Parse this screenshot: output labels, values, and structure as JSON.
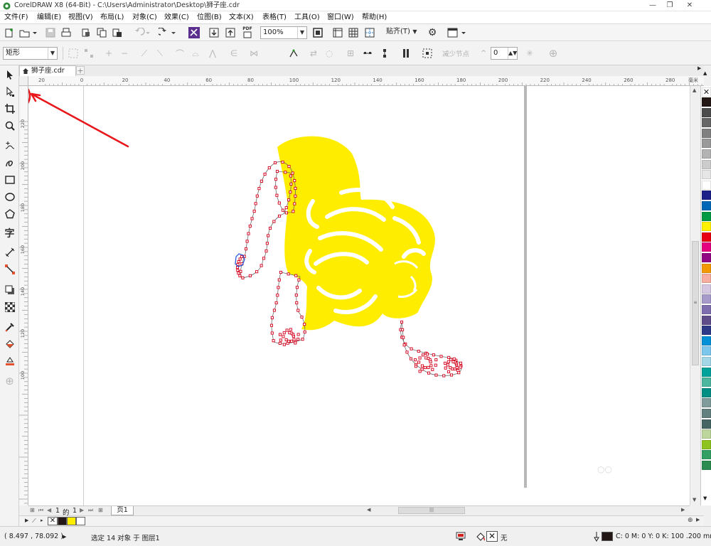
{
  "window": {
    "title": "CorelDRAW X8 (64-Bit) - C:\\Users\\Administrator\\Desktop\\狮子座.cdr",
    "minimize": "—",
    "restore": "❐",
    "close": "✕"
  },
  "menu": [
    {
      "label": "文件(F)"
    },
    {
      "label": "编辑(E)"
    },
    {
      "label": "视图(V)"
    },
    {
      "label": "布局(L)"
    },
    {
      "label": "对象(C)"
    },
    {
      "label": "效果(C)"
    },
    {
      "label": "位图(B)"
    },
    {
      "label": "文本(X)"
    },
    {
      "label": "表格(T)"
    },
    {
      "label": "工具(O)"
    },
    {
      "label": "窗口(W)"
    },
    {
      "label": "帮助(H)"
    }
  ],
  "standard_toolbar": {
    "pdf_label": "PDF",
    "zoom_value": "100%",
    "snap_label": "贴齐(T)"
  },
  "property_bar": {
    "shape_type": "矩形",
    "reduce_nodes_label": "减少节点",
    "smoothness_value": "0"
  },
  "document": {
    "tab_label": "狮子座.cdr"
  },
  "rulers": {
    "horizontal": [
      "20",
      "0",
      "20",
      "40",
      "60",
      "80",
      "100",
      "120",
      "140",
      "160",
      "180",
      "200",
      "220",
      "240",
      "260",
      "280",
      "毫米"
    ],
    "vertical": [
      "220",
      "200",
      "180",
      "160",
      "140",
      "120",
      "100"
    ]
  },
  "page_nav": {
    "current": "1",
    "of_label": "的",
    "total": "1",
    "page_tab": "页1"
  },
  "status": {
    "coordinates": "( 8.497 , 78.092 )",
    "selection_info": "选定 14 对象 于 图层1",
    "fill_none_label": "无",
    "outline_info": "C: 0 M: 0 Y: 0 K: 100  .200 mm"
  },
  "colors": {
    "lion_fill": "#FFED00",
    "node": "#D4001A",
    "selected_node": "#1E4FD8",
    "annotation": "#E8161A",
    "palette": [
      "#231815",
      "#4D4D4D",
      "#666666",
      "#808080",
      "#999999",
      "#B3B3B3",
      "#CCCCCC",
      "#E6E6E6",
      "#FFFFFF",
      "#1D2088",
      "#0068B7",
      "#009944",
      "#FFF100",
      "#E60012",
      "#E4007F",
      "#920783",
      "#F39800",
      "#F6ADA0",
      "#D4C7E1",
      "#A59ACA",
      "#7F6EAE",
      "#5F4D8A",
      "#2E3988",
      "#0090D7",
      "#7CC7EC",
      "#A3D6E6",
      "#00A29A",
      "#4CB69F",
      "#008E85",
      "#7F9B9A",
      "#64807F",
      "#456563",
      "#BCD69C",
      "#8FC31F",
      "#31A062",
      "#2C8B4F"
    ]
  }
}
